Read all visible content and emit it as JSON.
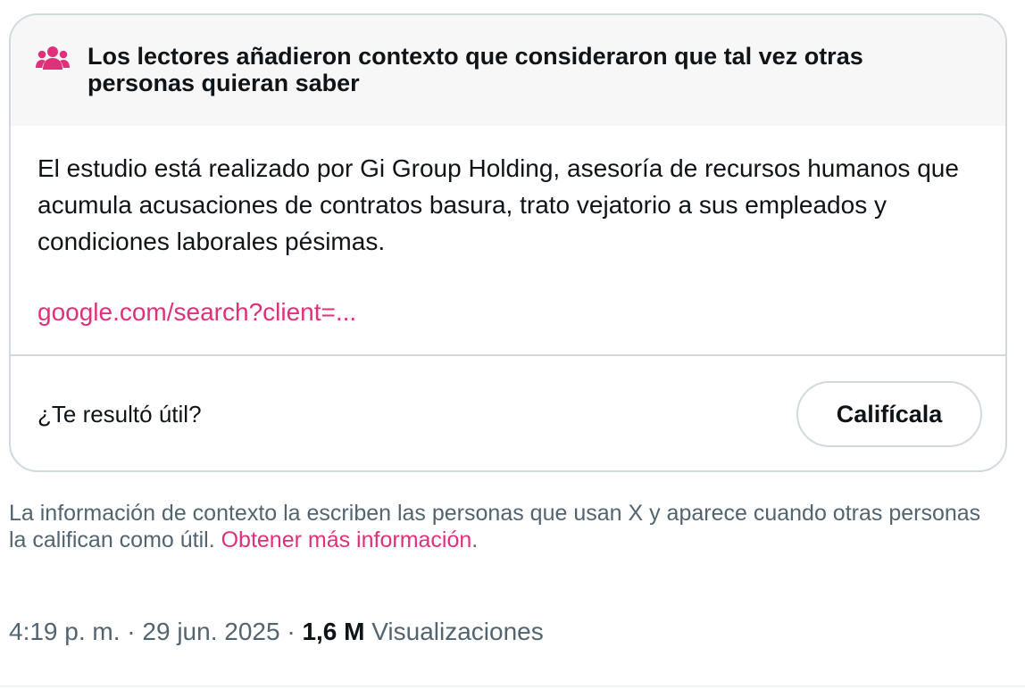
{
  "note": {
    "title": "Los lectores añadieron contexto que consideraron que tal vez otras personas quieran saber",
    "header_icon": "people-icon",
    "body": "El estudio está realizado por Gi Group Holding, asesoría de recursos humanos que acumula acusaciones de contratos basura, trato vejatorio a sus empleados y condiciones laborales pésimas.",
    "link_text": "google.com/search?client=...",
    "rating_question": "¿Te resultó útil?",
    "rate_button_label": "Califícala"
  },
  "info": {
    "text": "La información de contexto la escriben las personas que usan X y aparece cuando otras personas la califican como útil. ",
    "link_text": "Obtener más información",
    "suffix": "."
  },
  "meta": {
    "time": "4:19 p. m.",
    "separator": " · ",
    "date": "29 jun. 2025",
    "views_count": "1,6 M",
    "views_label": "Visualizaciones"
  },
  "colors": {
    "accent": "#e0307b",
    "text_primary": "#0f1419",
    "text_secondary": "#536471",
    "border": "#cfd9de",
    "header_bg": "#f7f7f7"
  }
}
